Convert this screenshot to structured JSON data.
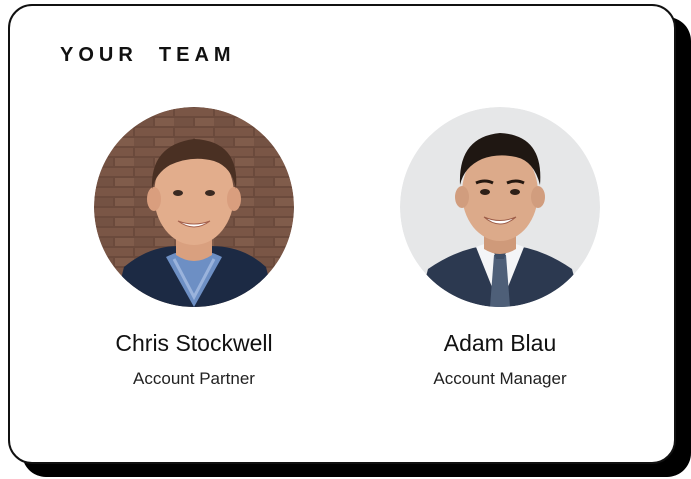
{
  "section": {
    "title": "YOUR  TEAM"
  },
  "team": [
    {
      "name": "Chris Stockwell",
      "role": "Account Partner"
    },
    {
      "name": "Adam Blau",
      "role": "Account Manager"
    }
  ],
  "colors": {
    "card_background": "#ffffff",
    "card_border": "#111111",
    "card_shadow": "#000000",
    "text": "#111111"
  }
}
